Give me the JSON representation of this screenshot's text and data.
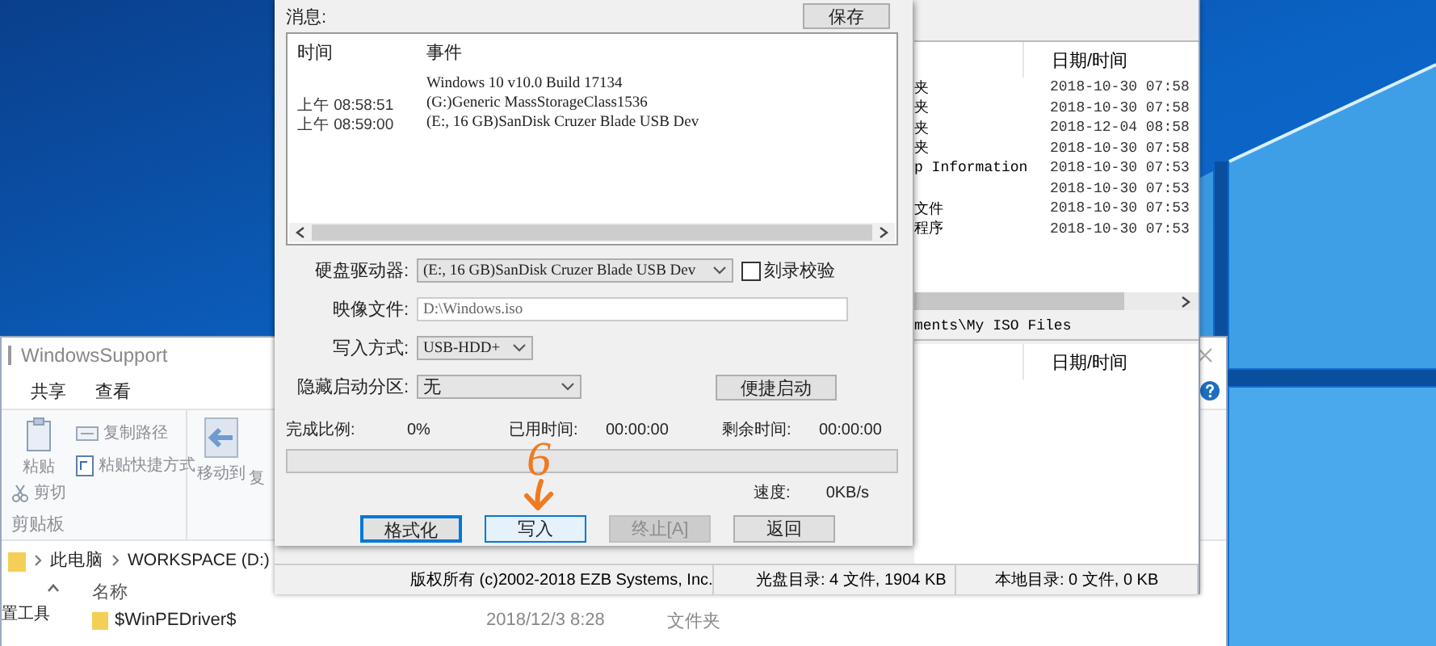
{
  "explorer": {
    "title": "WindowsSupport",
    "tabs": [
      {
        "label": "共享",
        "selected": false
      },
      {
        "label": "查看",
        "selected": false
      }
    ],
    "ribbon": {
      "paste": "粘贴",
      "copy_path": "复制路径",
      "paste_shortcut": "粘贴快捷方式",
      "cut": "剪切",
      "group": "剪贴板",
      "move_to": "移动到",
      "cut_off": "复"
    },
    "breadcrumb": [
      "此电脑",
      "WORKSPACE (D:)"
    ],
    "nav_items": [
      "置工具"
    ],
    "columns": [
      "名称"
    ],
    "rows": [
      {
        "name": "$WinPEDriver$",
        "modified": "2018/12/3 8:28",
        "type": "文件夹"
      }
    ]
  },
  "iso_window": {
    "file_list": {
      "columns": [
        "日期/时间"
      ],
      "rows": [
        {
          "name": "夹",
          "date": "2018-10-30 07:58"
        },
        {
          "name": "夹",
          "date": "2018-10-30 07:58"
        },
        {
          "name": "夹",
          "date": "2018-12-04 08:58"
        },
        {
          "name": "夹",
          "date": "2018-10-30 07:58"
        },
        {
          "name": "p Information",
          "date": "2018-10-30 07:53"
        },
        {
          "date": "2018-10-30 07:53"
        },
        {
          "name": "文件",
          "date": "2018-10-30 07:53"
        },
        {
          "name": "程序",
          "date": "2018-10-30 07:53"
        }
      ]
    },
    "local_path": "ments\\My ISO Files",
    "local_list": {
      "columns": [
        "日期/时间"
      ]
    },
    "status_bar": [
      "版权所有 (c)2002-2018 EZB Systems, Inc.",
      "光盘目录: 4 文件, 1904 KB",
      "本地目录: 0 文件, 0 KB"
    ]
  },
  "dialog": {
    "messages_label": "消息:",
    "save_button": "保存",
    "log": {
      "columns": [
        "时间",
        "事件"
      ],
      "rows": [
        {
          "event": "Windows 10 v10.0 Build 17134"
        },
        {
          "time": "上午 08:58:51",
          "event": "(G:)Generic MassStorageClass1536"
        },
        {
          "time": "上午 08:59:00",
          "event": "(E:, 16 GB)SanDisk Cruzer Blade USB Dev"
        }
      ]
    },
    "drive": {
      "label": "硬盘驱动器:",
      "value": "(E:, 16 GB)SanDisk Cruzer Blade USB Dev"
    },
    "verify": {
      "label": "刻录校验",
      "checked": false
    },
    "image_file": {
      "label": "映像文件:",
      "value": "D:\\Windows.iso"
    },
    "write_mode": {
      "label": "写入方式:",
      "value": "USB-HDD+"
    },
    "hidden_partition": {
      "label": "隐藏启动分区:",
      "value": "无"
    },
    "quick_boot_button": "便捷启动",
    "progress": {
      "done_label": "完成比例:",
      "done": "0%",
      "elapsed_label": "已用时间:",
      "elapsed": "00:00:00",
      "remaining_label": "剩余时间:",
      "remaining": "00:00:00",
      "level": 0,
      "speed_label": "速度:",
      "speed": "0KB/s"
    },
    "buttons": [
      {
        "label": "格式化",
        "focused": true,
        "hovered": false,
        "disabled": false
      },
      {
        "label": "写入",
        "focused": false,
        "hovered": true,
        "disabled": false
      },
      {
        "label": "终止[A]",
        "focused": false,
        "hovered": false,
        "disabled": true
      },
      {
        "label": "返回",
        "focused": false,
        "hovered": false,
        "disabled": false
      }
    ]
  },
  "annotation": {
    "label": "6"
  }
}
